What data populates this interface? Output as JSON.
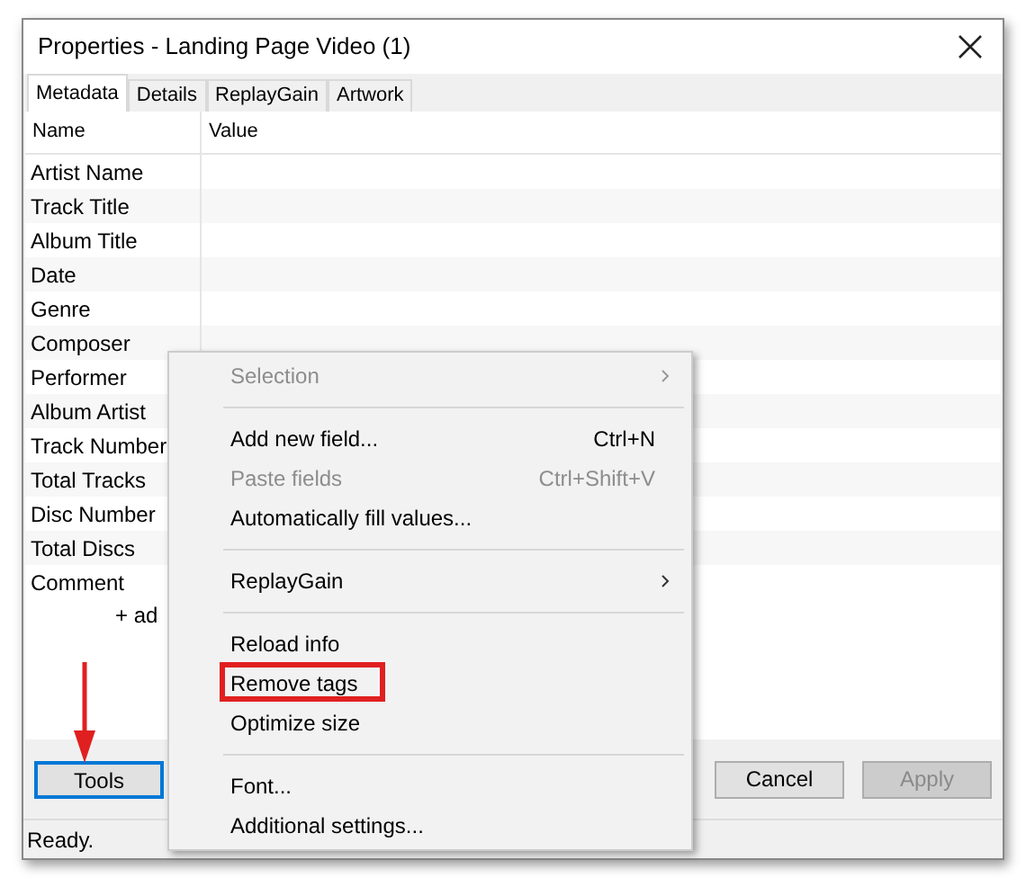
{
  "window": {
    "title": "Properties - Landing Page Video (1)"
  },
  "tabs": [
    {
      "label": "Metadata",
      "selected": true
    },
    {
      "label": "Details",
      "selected": false
    },
    {
      "label": "ReplayGain",
      "selected": false
    },
    {
      "label": "Artwork",
      "selected": false
    }
  ],
  "table": {
    "columns": [
      "Name",
      "Value"
    ],
    "rows": [
      "Artist Name",
      "Track Title",
      "Album Title",
      "Date",
      "Genre",
      "Composer",
      "Performer",
      "Album Artist",
      "Track Number",
      "Total Tracks",
      "Disc Number",
      "Total Discs",
      "Comment"
    ],
    "add_link": "+ ad"
  },
  "context_menu": {
    "items": [
      {
        "kind": "item",
        "label": "Selection",
        "disabled": true,
        "submenu": true,
        "highlighted": false
      },
      {
        "kind": "separator"
      },
      {
        "kind": "item",
        "label": "Add new field...",
        "shortcut": "Ctrl+N",
        "disabled": false,
        "submenu": false,
        "highlighted": false
      },
      {
        "kind": "item",
        "label": "Paste fields",
        "shortcut": "Ctrl+Shift+V",
        "disabled": true,
        "submenu": false,
        "highlighted": false
      },
      {
        "kind": "item",
        "label": "Automatically fill values...",
        "disabled": false,
        "submenu": false,
        "highlighted": false
      },
      {
        "kind": "separator"
      },
      {
        "kind": "item",
        "label": "ReplayGain",
        "disabled": false,
        "submenu": true,
        "highlighted": false
      },
      {
        "kind": "separator"
      },
      {
        "kind": "item",
        "label": "Reload info",
        "disabled": false,
        "submenu": false,
        "highlighted": false
      },
      {
        "kind": "item",
        "label": "Remove tags",
        "disabled": false,
        "submenu": false,
        "highlighted": true
      },
      {
        "kind": "item",
        "label": "Optimize size",
        "disabled": false,
        "submenu": false,
        "highlighted": false
      },
      {
        "kind": "separator"
      },
      {
        "kind": "item",
        "label": "Font...",
        "disabled": false,
        "submenu": false,
        "highlighted": false
      },
      {
        "kind": "item",
        "label": "Additional settings...",
        "disabled": false,
        "submenu": false,
        "highlighted": false
      }
    ]
  },
  "buttons": [
    {
      "label": "Tools",
      "disabled": false,
      "focused": true
    },
    {
      "label": "Cancel",
      "disabled": false,
      "focused": false
    },
    {
      "label": "Apply",
      "disabled": true,
      "focused": false
    }
  ],
  "status_bar": "Ready."
}
